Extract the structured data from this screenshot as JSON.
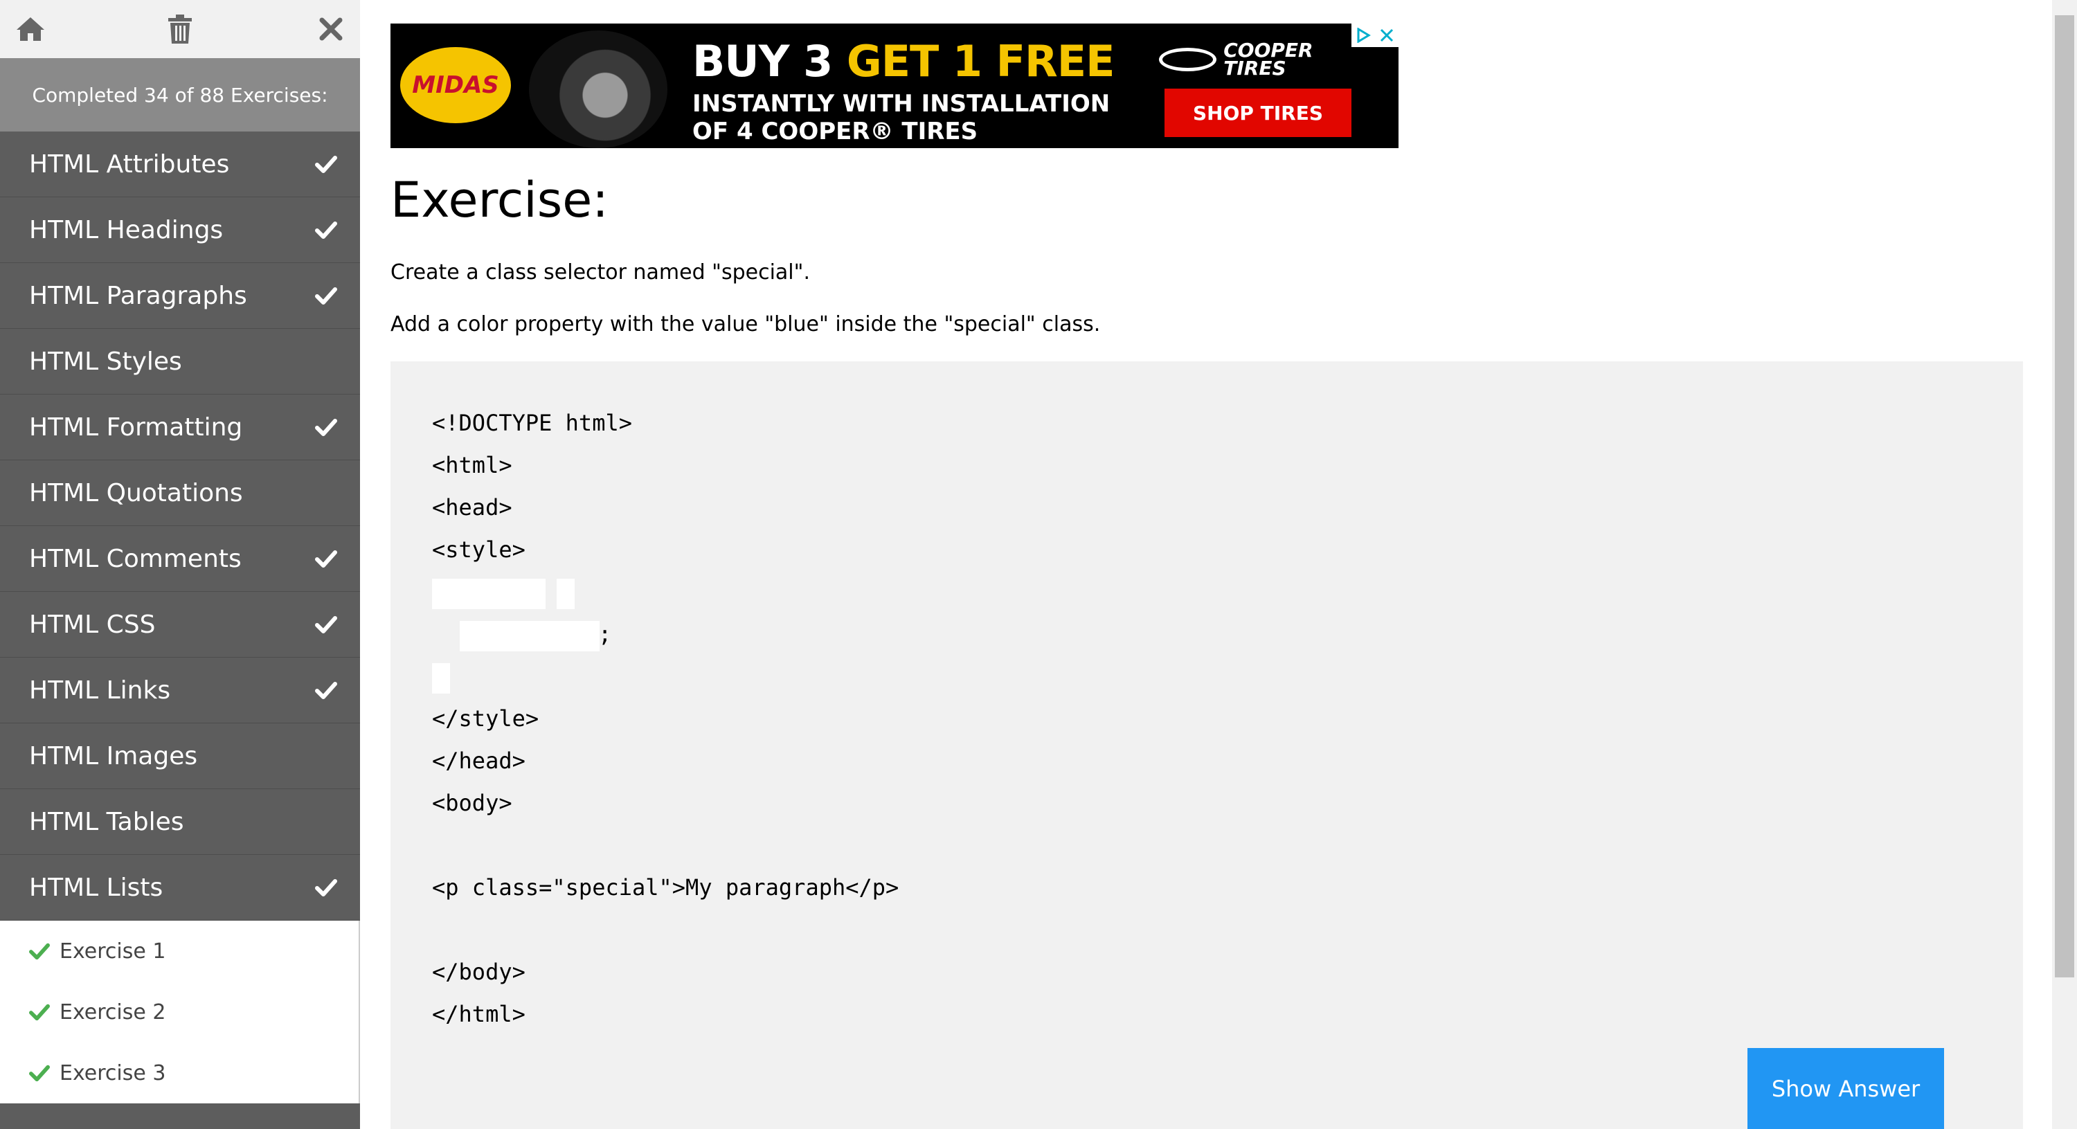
{
  "sidebar": {
    "toolbar": {
      "home_icon": "home-icon",
      "delete_icon": "trash-icon",
      "close_icon": "close-icon"
    },
    "progress_text": "Completed 34 of 88 Exercises:",
    "items": [
      {
        "label": "HTML Attributes",
        "completed": true
      },
      {
        "label": "HTML Headings",
        "completed": true
      },
      {
        "label": "HTML Paragraphs",
        "completed": true
      },
      {
        "label": "HTML Styles",
        "completed": false
      },
      {
        "label": "HTML Formatting",
        "completed": true
      },
      {
        "label": "HTML Quotations",
        "completed": false
      },
      {
        "label": "HTML Comments",
        "completed": true
      },
      {
        "label": "HTML CSS",
        "completed": true
      },
      {
        "label": "HTML Links",
        "completed": true
      },
      {
        "label": "HTML Images",
        "completed": false
      },
      {
        "label": "HTML Tables",
        "completed": false
      },
      {
        "label": "HTML Lists",
        "completed": true
      }
    ],
    "sub_items": [
      {
        "label": "Exercise 1",
        "completed": true
      },
      {
        "label": "Exercise 2",
        "completed": true
      },
      {
        "label": "Exercise 3",
        "completed": true
      }
    ]
  },
  "ad": {
    "logo": "MIDAS",
    "headline_white": "BUY 3 ",
    "headline_yellow": "GET 1 FREE",
    "line1": "INSTANTLY WITH INSTALLATION",
    "line2": "OF 4 COOPER® TIRES",
    "brand": "COOPER TIRES",
    "cta": "SHOP TIRES"
  },
  "exercise": {
    "title": "Exercise:",
    "instruction1": "Create a class selector named \"special\".",
    "instruction2": "Add a color property with the value \"blue\" inside the \"special\" class."
  },
  "code": {
    "doctype": "<!DOCTYPE html>",
    "html_open": "<html>",
    "head_open": "<head>",
    "style_open": "<style>",
    "semicolon": ";",
    "style_close": "</style>",
    "head_close": "</head>",
    "body_open": "<body>",
    "paragraph": "<p class=\"special\">My paragraph</p>",
    "body_close": "</body>",
    "html_close": "</html>"
  },
  "show_answer_label": "Show Answer",
  "colors": {
    "sidebar_bg": "#5d5d5d",
    "progress_bg": "#8a8a8a",
    "check_green": "#4caf50",
    "button_blue": "#2196f3",
    "code_bg": "#f1f1f1"
  }
}
